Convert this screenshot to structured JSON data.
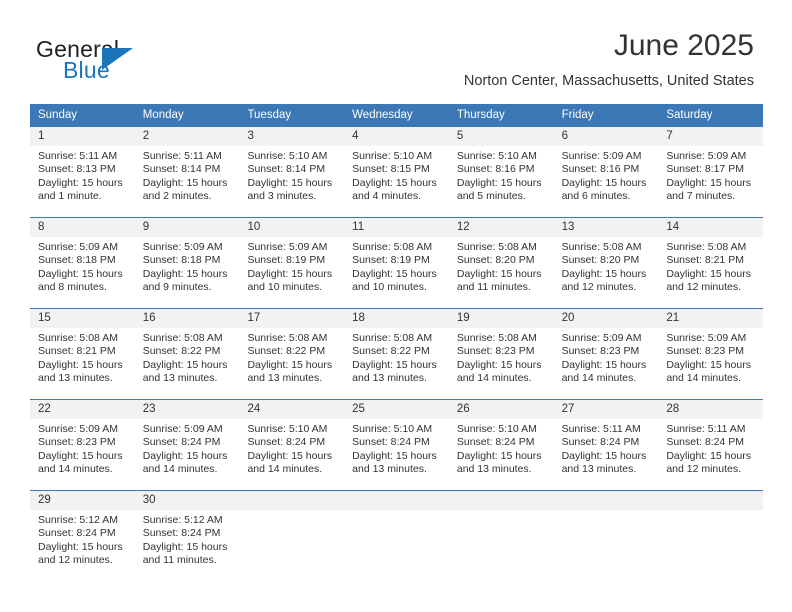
{
  "brand": {
    "name_part1": "General",
    "name_part2": "Blue",
    "accent_color": "#1b75bb"
  },
  "header": {
    "month_title": "June 2025",
    "location": "Norton Center, Massachusetts, United States"
  },
  "theme": {
    "header_blue": "#3b78b5",
    "daynum_gray": "#f2f2f2",
    "text_color": "#333333"
  },
  "calendar": {
    "weekdays": [
      "Sunday",
      "Monday",
      "Tuesday",
      "Wednesday",
      "Thursday",
      "Friday",
      "Saturday"
    ],
    "weeks": [
      [
        {
          "day": "1",
          "sunrise": "Sunrise: 5:11 AM",
          "sunset": "Sunset: 8:13 PM",
          "daylight": "Daylight: 15 hours and 1 minute."
        },
        {
          "day": "2",
          "sunrise": "Sunrise: 5:11 AM",
          "sunset": "Sunset: 8:14 PM",
          "daylight": "Daylight: 15 hours and 2 minutes."
        },
        {
          "day": "3",
          "sunrise": "Sunrise: 5:10 AM",
          "sunset": "Sunset: 8:14 PM",
          "daylight": "Daylight: 15 hours and 3 minutes."
        },
        {
          "day": "4",
          "sunrise": "Sunrise: 5:10 AM",
          "sunset": "Sunset: 8:15 PM",
          "daylight": "Daylight: 15 hours and 4 minutes."
        },
        {
          "day": "5",
          "sunrise": "Sunrise: 5:10 AM",
          "sunset": "Sunset: 8:16 PM",
          "daylight": "Daylight: 15 hours and 5 minutes."
        },
        {
          "day": "6",
          "sunrise": "Sunrise: 5:09 AM",
          "sunset": "Sunset: 8:16 PM",
          "daylight": "Daylight: 15 hours and 6 minutes."
        },
        {
          "day": "7",
          "sunrise": "Sunrise: 5:09 AM",
          "sunset": "Sunset: 8:17 PM",
          "daylight": "Daylight: 15 hours and 7 minutes."
        }
      ],
      [
        {
          "day": "8",
          "sunrise": "Sunrise: 5:09 AM",
          "sunset": "Sunset: 8:18 PM",
          "daylight": "Daylight: 15 hours and 8 minutes."
        },
        {
          "day": "9",
          "sunrise": "Sunrise: 5:09 AM",
          "sunset": "Sunset: 8:18 PM",
          "daylight": "Daylight: 15 hours and 9 minutes."
        },
        {
          "day": "10",
          "sunrise": "Sunrise: 5:09 AM",
          "sunset": "Sunset: 8:19 PM",
          "daylight": "Daylight: 15 hours and 10 minutes."
        },
        {
          "day": "11",
          "sunrise": "Sunrise: 5:08 AM",
          "sunset": "Sunset: 8:19 PM",
          "daylight": "Daylight: 15 hours and 10 minutes."
        },
        {
          "day": "12",
          "sunrise": "Sunrise: 5:08 AM",
          "sunset": "Sunset: 8:20 PM",
          "daylight": "Daylight: 15 hours and 11 minutes."
        },
        {
          "day": "13",
          "sunrise": "Sunrise: 5:08 AM",
          "sunset": "Sunset: 8:20 PM",
          "daylight": "Daylight: 15 hours and 12 minutes."
        },
        {
          "day": "14",
          "sunrise": "Sunrise: 5:08 AM",
          "sunset": "Sunset: 8:21 PM",
          "daylight": "Daylight: 15 hours and 12 minutes."
        }
      ],
      [
        {
          "day": "15",
          "sunrise": "Sunrise: 5:08 AM",
          "sunset": "Sunset: 8:21 PM",
          "daylight": "Daylight: 15 hours and 13 minutes."
        },
        {
          "day": "16",
          "sunrise": "Sunrise: 5:08 AM",
          "sunset": "Sunset: 8:22 PM",
          "daylight": "Daylight: 15 hours and 13 minutes."
        },
        {
          "day": "17",
          "sunrise": "Sunrise: 5:08 AM",
          "sunset": "Sunset: 8:22 PM",
          "daylight": "Daylight: 15 hours and 13 minutes."
        },
        {
          "day": "18",
          "sunrise": "Sunrise: 5:08 AM",
          "sunset": "Sunset: 8:22 PM",
          "daylight": "Daylight: 15 hours and 13 minutes."
        },
        {
          "day": "19",
          "sunrise": "Sunrise: 5:08 AM",
          "sunset": "Sunset: 8:23 PM",
          "daylight": "Daylight: 15 hours and 14 minutes."
        },
        {
          "day": "20",
          "sunrise": "Sunrise: 5:09 AM",
          "sunset": "Sunset: 8:23 PM",
          "daylight": "Daylight: 15 hours and 14 minutes."
        },
        {
          "day": "21",
          "sunrise": "Sunrise: 5:09 AM",
          "sunset": "Sunset: 8:23 PM",
          "daylight": "Daylight: 15 hours and 14 minutes."
        }
      ],
      [
        {
          "day": "22",
          "sunrise": "Sunrise: 5:09 AM",
          "sunset": "Sunset: 8:23 PM",
          "daylight": "Daylight: 15 hours and 14 minutes."
        },
        {
          "day": "23",
          "sunrise": "Sunrise: 5:09 AM",
          "sunset": "Sunset: 8:24 PM",
          "daylight": "Daylight: 15 hours and 14 minutes."
        },
        {
          "day": "24",
          "sunrise": "Sunrise: 5:10 AM",
          "sunset": "Sunset: 8:24 PM",
          "daylight": "Daylight: 15 hours and 14 minutes."
        },
        {
          "day": "25",
          "sunrise": "Sunrise: 5:10 AM",
          "sunset": "Sunset: 8:24 PM",
          "daylight": "Daylight: 15 hours and 13 minutes."
        },
        {
          "day": "26",
          "sunrise": "Sunrise: 5:10 AM",
          "sunset": "Sunset: 8:24 PM",
          "daylight": "Daylight: 15 hours and 13 minutes."
        },
        {
          "day": "27",
          "sunrise": "Sunrise: 5:11 AM",
          "sunset": "Sunset: 8:24 PM",
          "daylight": "Daylight: 15 hours and 13 minutes."
        },
        {
          "day": "28",
          "sunrise": "Sunrise: 5:11 AM",
          "sunset": "Sunset: 8:24 PM",
          "daylight": "Daylight: 15 hours and 12 minutes."
        }
      ],
      [
        {
          "day": "29",
          "sunrise": "Sunrise: 5:12 AM",
          "sunset": "Sunset: 8:24 PM",
          "daylight": "Daylight: 15 hours and 12 minutes."
        },
        {
          "day": "30",
          "sunrise": "Sunrise: 5:12 AM",
          "sunset": "Sunset: 8:24 PM",
          "daylight": "Daylight: 15 hours and 11 minutes."
        },
        {
          "day": "",
          "sunrise": "",
          "sunset": "",
          "daylight": ""
        },
        {
          "day": "",
          "sunrise": "",
          "sunset": "",
          "daylight": ""
        },
        {
          "day": "",
          "sunrise": "",
          "sunset": "",
          "daylight": ""
        },
        {
          "day": "",
          "sunrise": "",
          "sunset": "",
          "daylight": ""
        },
        {
          "day": "",
          "sunrise": "",
          "sunset": "",
          "daylight": ""
        }
      ]
    ]
  }
}
